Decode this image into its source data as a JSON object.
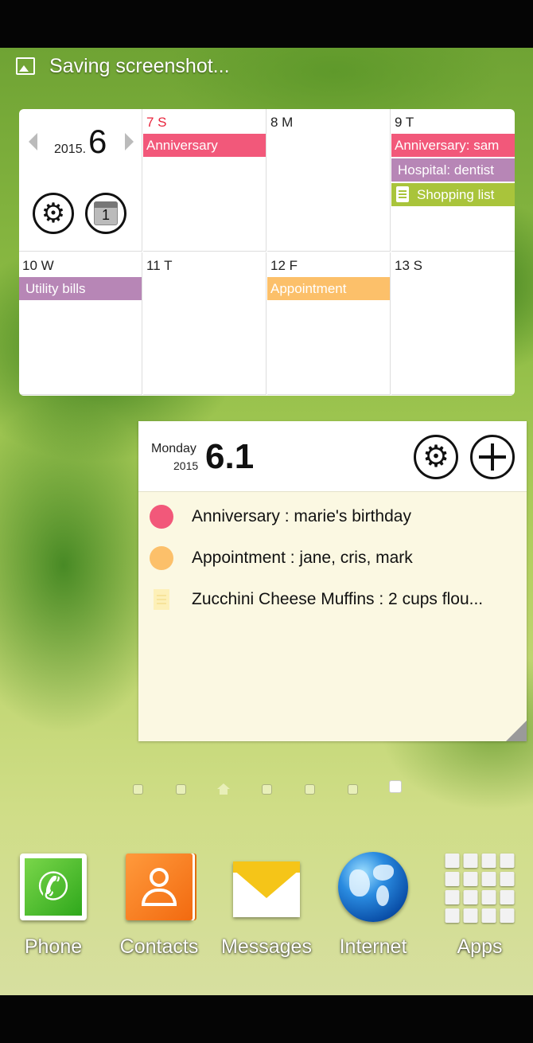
{
  "status_bar": {
    "notification_text": "Saving screenshot..."
  },
  "calendar_widget": {
    "year": "2015.",
    "month": "6",
    "today_icon_number": "1",
    "days": [
      {
        "label": "7 S",
        "events": [
          {
            "title": "Anniversary",
            "color": "#f2587a"
          }
        ]
      },
      {
        "label": "8 M",
        "events": []
      },
      {
        "label": "9 T",
        "events": [
          {
            "title": "Anniversary: sam",
            "color": "#f2587a"
          },
          {
            "title": "Hospital: dentist",
            "color": "#b786b6"
          },
          {
            "title": "Shopping list",
            "color": "#a9c43b",
            "icon": "memo-icon"
          }
        ]
      },
      {
        "label": "10 W",
        "events": [
          {
            "title": "Utility bills",
            "color": "#b786b6"
          }
        ]
      },
      {
        "label": "11 T",
        "events": []
      },
      {
        "label": "12 F",
        "events": [
          {
            "title": "Appointment",
            "color": "#fcc06a"
          }
        ]
      },
      {
        "label": "13 S",
        "events": []
      }
    ]
  },
  "agenda_widget": {
    "weekday": "Monday",
    "year": "2015",
    "date": "6.1",
    "items": [
      {
        "text": "Anniversary : marie's birthday",
        "color": "#f2587a",
        "icon": "dot"
      },
      {
        "text": "Appointment : jane, cris, mark",
        "color": "#fcc06a",
        "icon": "dot"
      },
      {
        "text": "Zucchini Cheese Muffins :  2 cups flou...",
        "color": "#fdf0b8",
        "icon": "memo-icon"
      }
    ]
  },
  "pager": {
    "page_count": 7,
    "home_index": 2,
    "active_index": 6
  },
  "dock": [
    {
      "label": "Phone",
      "icon": "phone-icon"
    },
    {
      "label": "Contacts",
      "icon": "contacts-icon"
    },
    {
      "label": "Messages",
      "icon": "messages-icon"
    },
    {
      "label": "Internet",
      "icon": "globe-icon"
    },
    {
      "label": "Apps",
      "icon": "apps-grid-icon"
    }
  ]
}
